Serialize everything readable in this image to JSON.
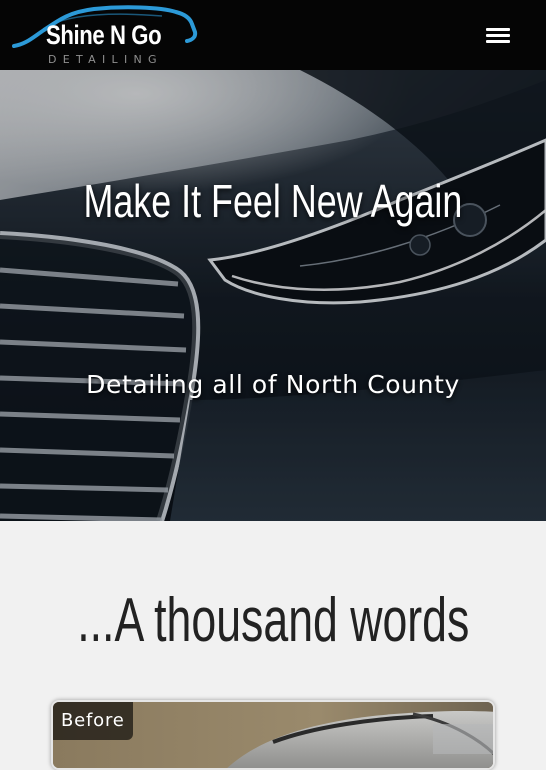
{
  "header": {
    "brand_name": "Shine N Go",
    "brand_sub": "DETAILING",
    "menu_icon": "hamburger-menu-icon"
  },
  "hero": {
    "title": "Make It Feel New Again",
    "subtitle": "Detailing all of North County"
  },
  "gallery": {
    "heading": "...A thousand words",
    "before_label": "Before"
  },
  "colors": {
    "header_bg": "#050505",
    "logo_swoosh": "#2c9ad8",
    "page_bg": "#f1f1f1",
    "heading_text": "#222222"
  }
}
